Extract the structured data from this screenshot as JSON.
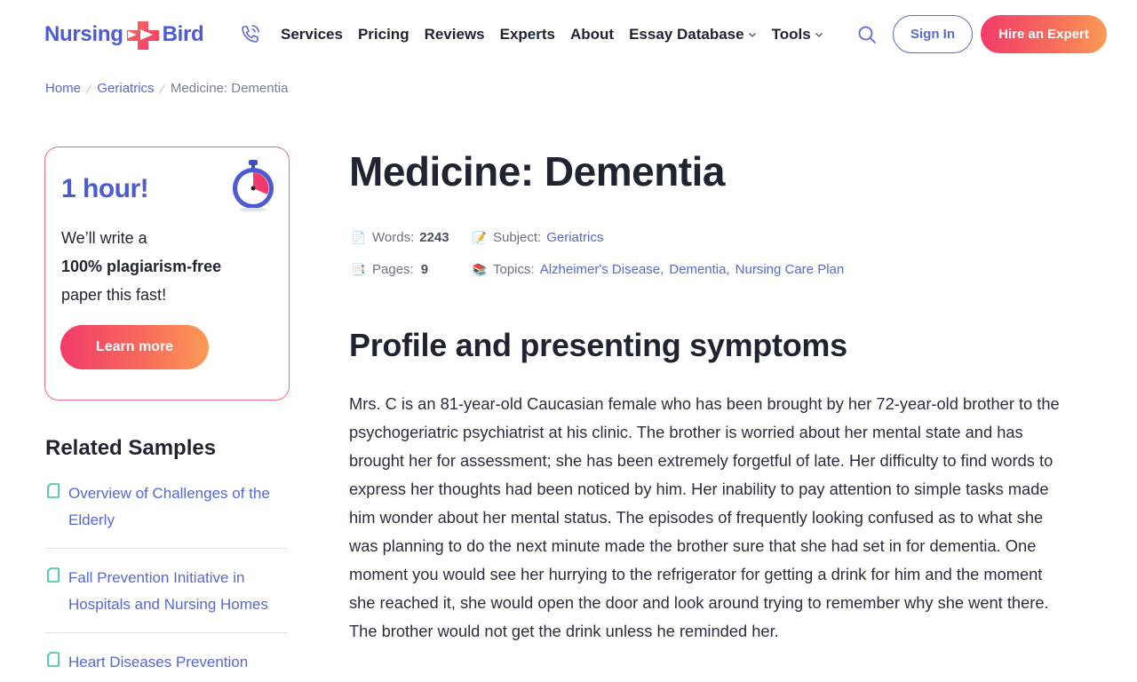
{
  "header": {
    "logo_left": "Nursing",
    "logo_right": "Bird",
    "nav": [
      {
        "label": "Services",
        "dropdown": false
      },
      {
        "label": "Pricing",
        "dropdown": false
      },
      {
        "label": "Reviews",
        "dropdown": false
      },
      {
        "label": "Experts",
        "dropdown": false
      },
      {
        "label": "About",
        "dropdown": false
      },
      {
        "label": "Essay Database",
        "dropdown": true
      },
      {
        "label": "Tools",
        "dropdown": true
      }
    ],
    "sign_in": "Sign In",
    "hire": "Hire an Expert",
    "icons": [
      "phone-icon",
      "search-icon"
    ]
  },
  "breadcrumb": {
    "home": "Home",
    "category": "Geriatrics",
    "current": "Medicine: Dementia"
  },
  "promo": {
    "headline": "1 hour!",
    "line1": "We’ll write a",
    "line2": "100% plagiarism-free",
    "line3": "paper this fast!",
    "button": "Learn more"
  },
  "related": {
    "title": "Related Samples",
    "items": [
      "Overview of Challenges of the Elderly",
      "Fall Prevention Initiative in Hospitals and Nursing Homes",
      "Heart Diseases Prevention"
    ]
  },
  "article": {
    "title": "Medicine: Dementia",
    "meta": {
      "words_label": "Words:",
      "words_value": "2243",
      "subject_label": "Subject:",
      "subject_value": "Geriatrics",
      "pages_label": "Pages:",
      "pages_value": "9",
      "topics_label": "Topics:",
      "topic1": "Alzheimer's Disease",
      "topic2": "Dementia",
      "topic3": "Nursing Care Plan",
      "comma": ","
    },
    "section_title": "Profile and presenting symptoms",
    "paragraph": "Mrs. C is an 81-year-old Caucasian female who has been brought by her 72-year-old brother to the psychogeriatric psychiatrist at his clinic. The brother is worried about her mental state and has brought her for assessment; she has been extremely forgetful of late. Her difficulty to find words to express her thoughts had been noticed by him. Her inability to pay attention to simple tasks made him wonder about her mental status. The episodes of frequently looking confused as to what she was planning to do the next minute made the brother sure that she had set in for dementia. One moment you would see her hurrying to the refrigerator for getting a drink for him and the moment she reached it, she would open the door and look around trying to remember why she went there. The brother would not get the drink unless he reminded her."
  },
  "colors": {
    "brand_blue": "#4a5bd4",
    "link_blue": "#5468d6",
    "cta_start": "#f23b6a",
    "cta_end": "#fb9a55",
    "promo_border": "#f06a7e",
    "text_dark": "#1f2433"
  }
}
